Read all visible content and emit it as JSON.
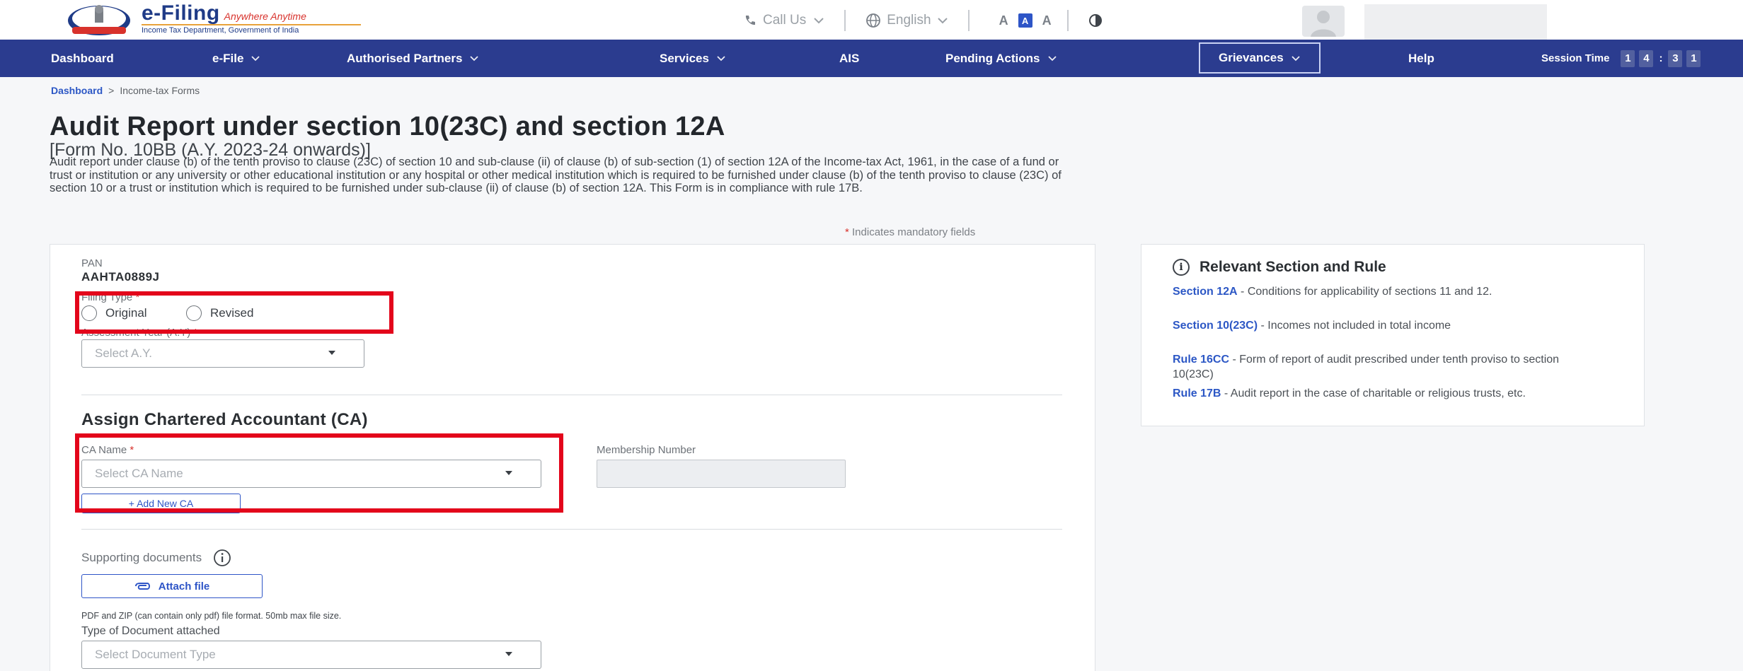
{
  "header": {
    "brand_name": "e-Filing",
    "brand_tagline": "Anywhere Anytime",
    "brand_subtitle": "Income Tax Department, Government of India",
    "call_us": "Call Us",
    "language": "English",
    "font_decrease": "A",
    "font_default": "A",
    "font_increase": "A"
  },
  "nav": {
    "items": [
      {
        "label": "Dashboard"
      },
      {
        "label": "e-File"
      },
      {
        "label": "Authorised Partners"
      },
      {
        "label": "Services"
      },
      {
        "label": "AIS"
      },
      {
        "label": "Pending Actions"
      },
      {
        "label": "Grievances"
      },
      {
        "label": "Help"
      }
    ],
    "session_label": "Session Time",
    "session_digits": [
      "1",
      "4",
      "3",
      "1"
    ]
  },
  "breadcrumb": {
    "home": "Dashboard",
    "separator": ">",
    "current": "Income-tax Forms"
  },
  "page": {
    "title": "Audit Report under section 10(23C) and section 12A",
    "subtitle": "[Form No. 10BB (A.Y. 2023-24 onwards)]",
    "description": "Audit report under clause (b) of the tenth proviso to clause (23C) of section 10 and sub-clause (ii) of clause (b) of sub-section (1) of section 12A of the Income-tax Act, 1961, in the case of a fund or trust or institution or any university or other educational institution or any hospital or other medical institution which is required to be furnished under clause (b) of the tenth proviso to clause (23C) of section 10 or a trust or institution which is required to be furnished under sub-clause (ii) of clause (b) of section 12A. This Form is in compliance with rule 17B.",
    "mandatory_star": "*",
    "mandatory_note": "Indicates mandatory fields"
  },
  "form": {
    "pan_label": "PAN",
    "pan_value": "AAHTA0889J",
    "filing_type_label": "Filing Type",
    "filing_options": [
      "Original",
      "Revised"
    ],
    "ay_label": "Assessment Year (A.Y)",
    "ay_placeholder": "Select A.Y.",
    "ca_section_title": "Assign Chartered Accountant (CA)",
    "ca_name_label": "CA Name",
    "ca_name_placeholder": "Select CA Name",
    "membership_label": "Membership Number",
    "add_ca_button": "+ Add New CA",
    "supporting_docs_label": "Supporting documents",
    "attach_button": "Attach file",
    "file_help": "PDF and ZIP (can contain only pdf) file format. 50mb max file size.",
    "doc_type_label": "Type of Document attached",
    "doc_type_placeholder": "Select Document Type",
    "required_star": "*"
  },
  "side": {
    "title": "Relevant Section and Rule",
    "rules": [
      {
        "link": "Section 12A",
        "text": " - Conditions for applicability of sections 11 and 12."
      },
      {
        "link": "Section 10(23C)",
        "text": " - Incomes not included in total income"
      },
      {
        "link": "Rule 16CC",
        "text": " - Form of report of audit prescribed under tenth proviso to section 10(23C)"
      },
      {
        "link": "Rule 17B",
        "text": " - Audit report in the case of charitable or religious trusts, etc."
      }
    ]
  },
  "colors": {
    "nav_bg": "#2b3c8f",
    "link_blue": "#2c57c5",
    "highlight_red": "#e3051b",
    "brand_blue": "#1f3b87"
  }
}
